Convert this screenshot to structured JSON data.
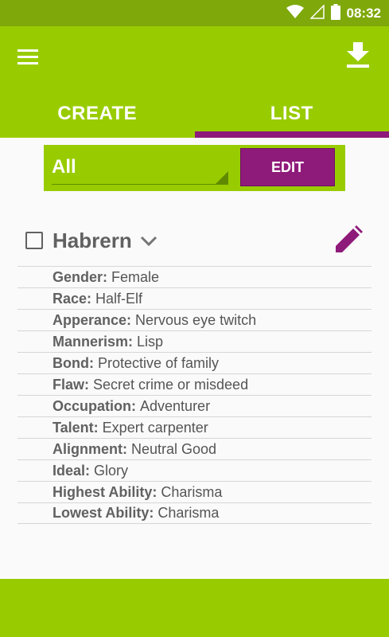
{
  "status_bar": {
    "time": "08:32",
    "icons": [
      "wifi-icon",
      "signal-icon",
      "battery-icon"
    ]
  },
  "toolbar": {
    "menu_icon": "menu-icon",
    "download_icon": "download-icon"
  },
  "tabs": [
    {
      "label": "CREATE",
      "selected": false
    },
    {
      "label": "LIST",
      "selected": true
    }
  ],
  "filter": {
    "selected": "All",
    "edit_label": "EDIT"
  },
  "character": {
    "name": "Habrern",
    "checked": false,
    "attributes": [
      {
        "label": "Gender:",
        "value": "Female"
      },
      {
        "label": "Race:",
        "value": "Half-Elf"
      },
      {
        "label": "Apperance:",
        "value": "Nervous eye twitch"
      },
      {
        "label": "Mannerism:",
        "value": "Lisp"
      },
      {
        "label": "Bond:",
        "value": "Protective of family"
      },
      {
        "label": "Flaw:",
        "value": "Secret crime or misdeed"
      },
      {
        "label": "Occupation:",
        "value": "Adventurer"
      },
      {
        "label": "Talent:",
        "value": "Expert carpenter"
      },
      {
        "label": "Alignment:",
        "value": "Neutral Good"
      },
      {
        "label": "Ideal:",
        "value": "Glory"
      },
      {
        "label": "Highest Ability:",
        "value": "Charisma"
      },
      {
        "label": "Lowest Ability:",
        "value": "Charisma"
      }
    ]
  },
  "colors": {
    "primary": "#99cc00",
    "primary_dark": "#7fa80a",
    "accent": "#8e1a7a",
    "text": "#616161"
  }
}
